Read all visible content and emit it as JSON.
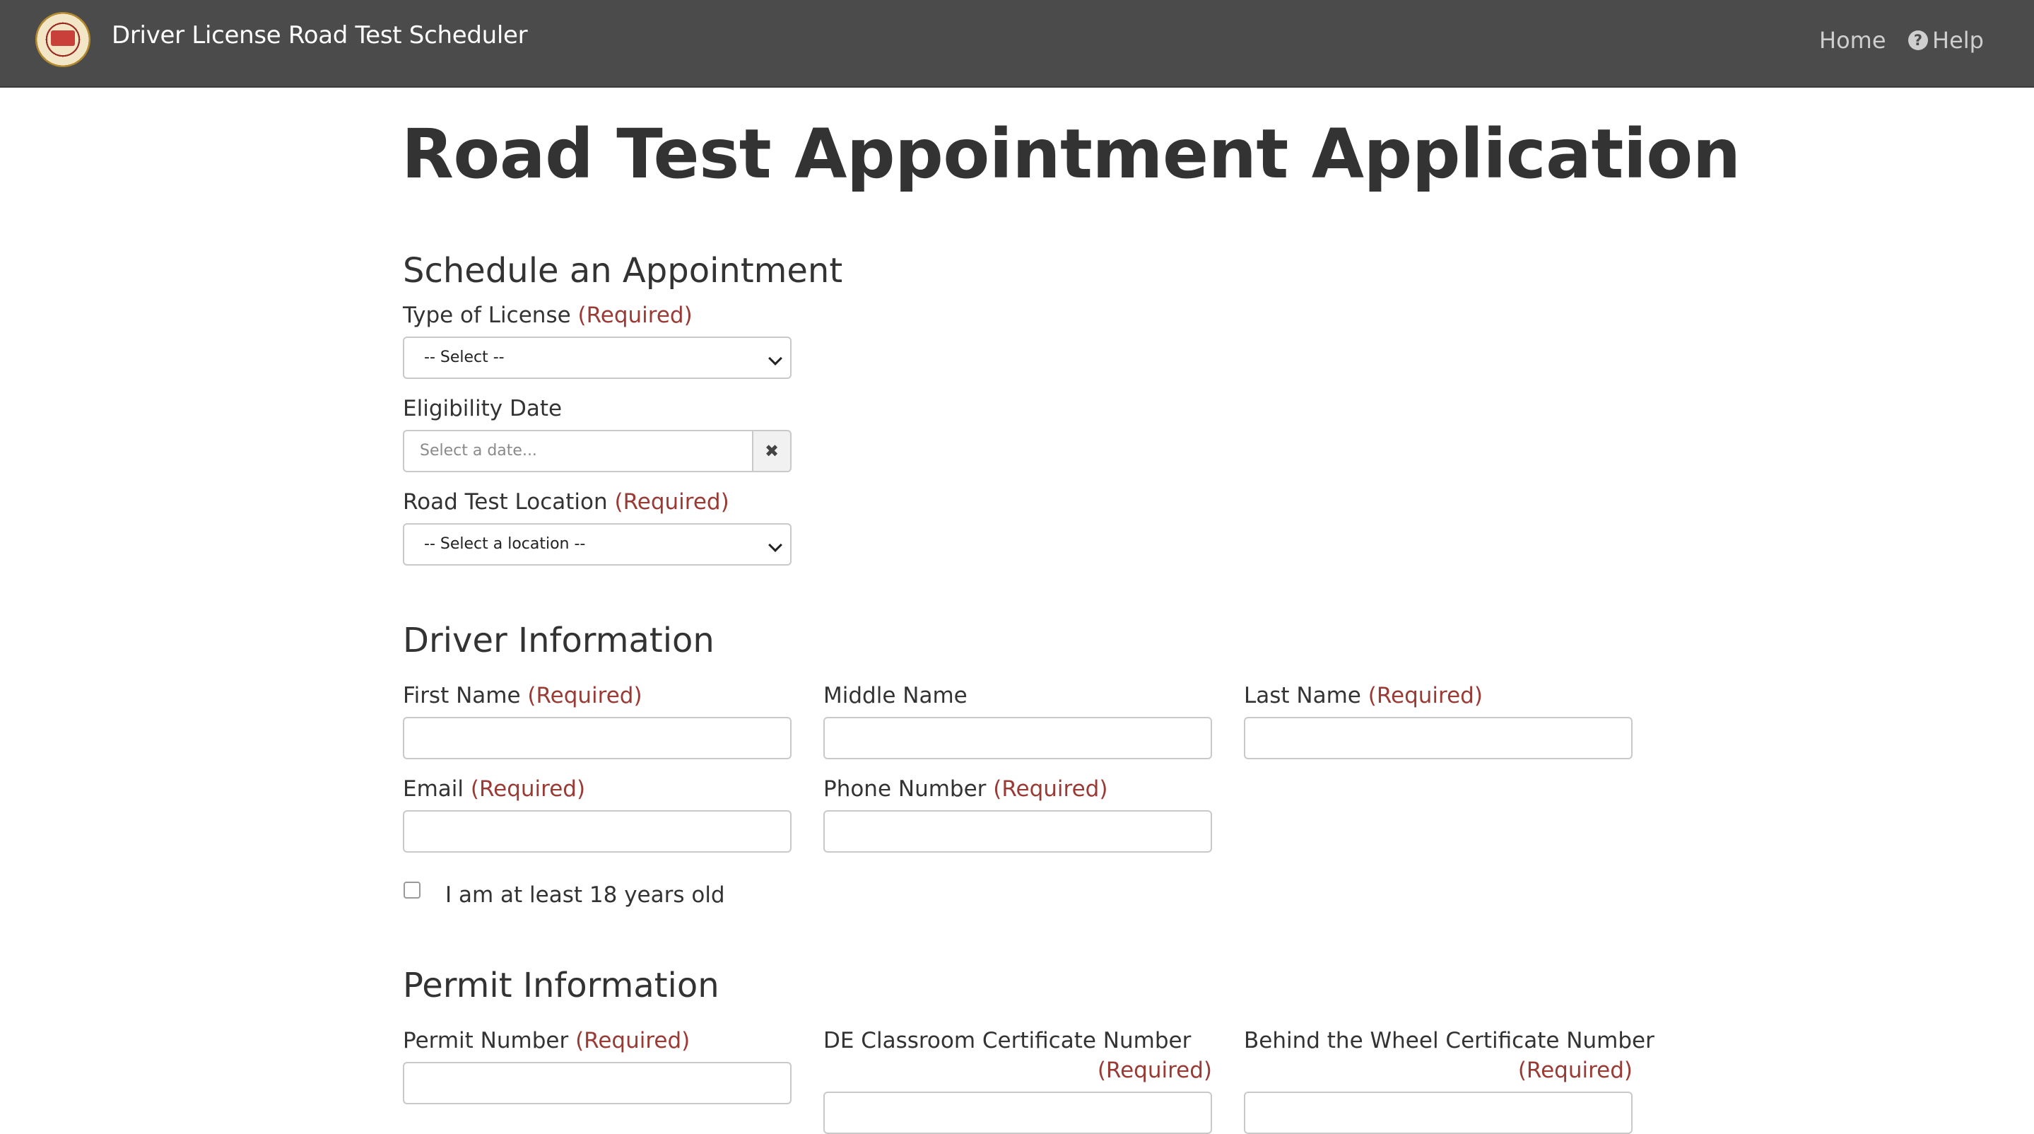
{
  "header": {
    "logo_icon": "state-seal-logo",
    "title": "Driver License Road Test Scheduler",
    "nav": {
      "home": "Home",
      "help": "Help",
      "help_icon": "question-circle-icon"
    }
  },
  "page": {
    "title": "Road Test Appointment Application"
  },
  "required_text": "(Required)",
  "schedule": {
    "heading": "Schedule an Appointment",
    "license_type": {
      "label": "Type of License",
      "value": "-- Select --"
    },
    "eligibility_date": {
      "label": "Eligibility Date",
      "placeholder": "Select a date...",
      "clear_icon": "close-icon"
    },
    "location": {
      "label": "Road Test Location",
      "value": "-- Select a location --"
    }
  },
  "driver": {
    "heading": "Driver Information",
    "first_name": "First Name",
    "middle_name": "Middle Name",
    "last_name": "Last Name",
    "email": "Email",
    "phone": "Phone Number",
    "age_checkbox": "I am at least 18 years old"
  },
  "permit": {
    "heading": "Permit Information",
    "permit_number": "Permit Number",
    "classroom_cert": "DE Classroom Certificate Number",
    "wheel_cert": "Behind the Wheel Certificate Number"
  },
  "colors": {
    "navbar": "#4b4b4b",
    "required": "#9a3a34",
    "text": "#333333"
  }
}
